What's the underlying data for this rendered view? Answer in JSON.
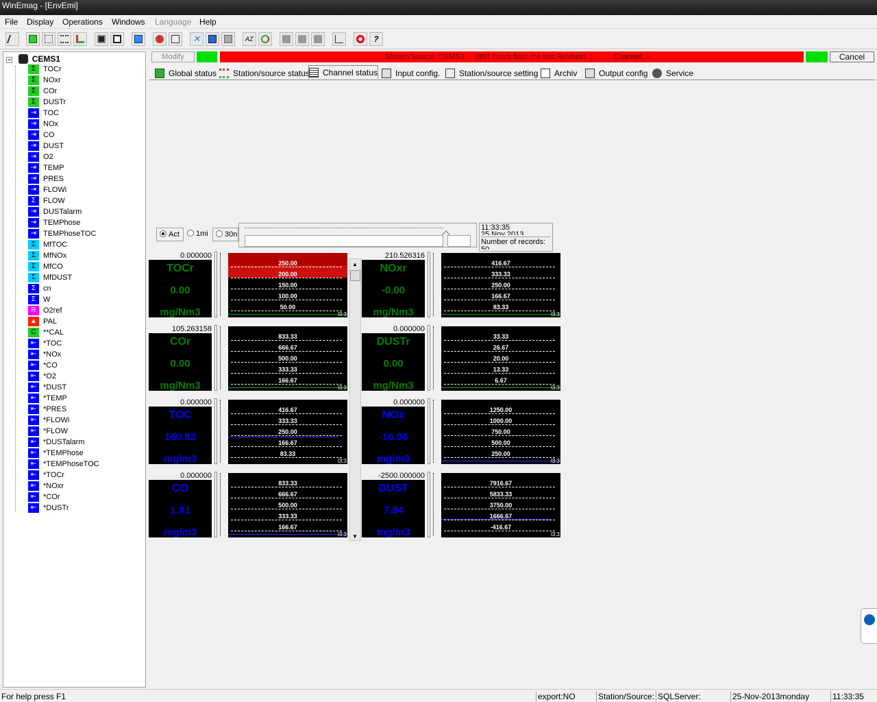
{
  "window": {
    "title": "WinEmag - [EnvEmi]"
  },
  "menu": {
    "file": "File",
    "display": "Display",
    "operations": "Operations",
    "windows": "Windows",
    "language": "Language",
    "help": "Help"
  },
  "tree": {
    "root": "CEMS1",
    "items": [
      {
        "label": "TOCr",
        "icon": "sum-icon",
        "color": "#22cc22"
      },
      {
        "label": "NOxr",
        "icon": "sum-icon",
        "color": "#22cc22"
      },
      {
        "label": "COr",
        "icon": "sum-icon",
        "color": "#22cc22"
      },
      {
        "label": "DUSTr",
        "icon": "sum-icon",
        "color": "#22cc22"
      },
      {
        "label": "TOC",
        "icon": "input-arrow-icon",
        "color": "#0000ff"
      },
      {
        "label": "NOx",
        "icon": "input-arrow-icon",
        "color": "#0000ff"
      },
      {
        "label": "CO",
        "icon": "input-arrow-icon",
        "color": "#0000ff"
      },
      {
        "label": "DUST",
        "icon": "input-arrow-icon",
        "color": "#0000ff"
      },
      {
        "label": "O2",
        "icon": "input-arrow-icon",
        "color": "#0000ff"
      },
      {
        "label": "TEMP",
        "icon": "input-arrow-icon",
        "color": "#0000ff"
      },
      {
        "label": "PRES",
        "icon": "input-arrow-icon",
        "color": "#0000ff"
      },
      {
        "label": "FLOWi",
        "icon": "input-arrow-icon",
        "color": "#0000ff"
      },
      {
        "label": "FLOW",
        "icon": "sum-icon",
        "color": "#0000ff"
      },
      {
        "label": "DUSTalarm",
        "icon": "input-arrow-icon",
        "color": "#0000ff"
      },
      {
        "label": "TEMPhose",
        "icon": "input-arrow-icon",
        "color": "#0000ff"
      },
      {
        "label": "TEMPhoseTOC",
        "icon": "input-arrow-icon",
        "color": "#0000ff"
      },
      {
        "label": "MfTOC",
        "icon": "sum-icon",
        "color": "#00ccff"
      },
      {
        "label": "MfNOx",
        "icon": "sum-icon",
        "color": "#00ccff"
      },
      {
        "label": "MfCO",
        "icon": "sum-icon",
        "color": "#00ccff"
      },
      {
        "label": "MfDUST",
        "icon": "sum-icon",
        "color": "#00ccff"
      },
      {
        "label": "cn",
        "icon": "sum-icon",
        "color": "#0000ff"
      },
      {
        "label": "W",
        "icon": "sum-icon",
        "color": "#0000ff"
      },
      {
        "label": "O2ref",
        "icon": "r-icon",
        "color": "#ff00ff"
      },
      {
        "label": "PAL",
        "icon": "alarm-icon",
        "color": "#ff2200"
      },
      {
        "label": "**CAL",
        "icon": "c-icon",
        "color": "#22cc22"
      },
      {
        "label": "*TOC",
        "icon": "output-arrow-icon",
        "color": "#0000ff"
      },
      {
        "label": "*NOx",
        "icon": "output-arrow-icon",
        "color": "#0000ff"
      },
      {
        "label": "*CO",
        "icon": "output-arrow-icon",
        "color": "#0000ff"
      },
      {
        "label": "*O2",
        "icon": "output-arrow-icon",
        "color": "#0000ff"
      },
      {
        "label": "*DUST",
        "icon": "output-arrow-icon",
        "color": "#0000ff"
      },
      {
        "label": "*TEMP",
        "icon": "output-arrow-icon",
        "color": "#0000ff"
      },
      {
        "label": "*PRES",
        "icon": "output-arrow-icon",
        "color": "#0000ff"
      },
      {
        "label": "*FLOWi",
        "icon": "output-arrow-icon",
        "color": "#0000ff"
      },
      {
        "label": "*FLOW",
        "icon": "output-arrow-icon",
        "color": "#0000ff"
      },
      {
        "label": "*DUSTalarm",
        "icon": "output-arrow-icon",
        "color": "#0000ff"
      },
      {
        "label": "*TEMPhose",
        "icon": "output-arrow-icon",
        "color": "#0000ff"
      },
      {
        "label": "*TEMPhoseTOC",
        "icon": "output-arrow-icon",
        "color": "#0000ff"
      },
      {
        "label": "*TOCr",
        "icon": "output-arrow-icon",
        "color": "#0000ff"
      },
      {
        "label": "*NOxr",
        "icon": "output-arrow-icon",
        "color": "#0000ff"
      },
      {
        "label": "*COr",
        "icon": "output-arrow-icon",
        "color": "#0000ff"
      },
      {
        "label": "*DUSTr",
        "icon": "output-arrow-icon",
        "color": "#0000ff"
      }
    ]
  },
  "infobar": {
    "modify": "Modify",
    "station_text": "Station/Source: CEMS1     (993 hours from the last Revision  )          Channel: --",
    "cancel": "Cancel"
  },
  "tabs": [
    {
      "label": "Global status",
      "icon": "global-status-icon"
    },
    {
      "label": "Station/source status",
      "icon": "station-status-icon"
    },
    {
      "label": "Channel status",
      "icon": "channel-status-icon",
      "active": true
    },
    {
      "label": "Input config.",
      "icon": "input-config-icon"
    },
    {
      "label": "Station/source setting",
      "icon": "station-setting-icon"
    },
    {
      "label": "Archiv",
      "icon": "archiv-icon"
    },
    {
      "label": "Output config",
      "icon": "output-config-icon"
    },
    {
      "label": "Service",
      "icon": "service-icon"
    }
  ],
  "time_controls": {
    "act": "Act",
    "one_min": "1mi",
    "thirty_min": "30n"
  },
  "time_info": {
    "time": "11:33:35",
    "date_partial": "25 Nov 2013",
    "records_label": "Number of records:",
    "records_partial": "50"
  },
  "channels": [
    {
      "name": "TOCr",
      "value": "0.00",
      "unit": "mg/Nm3",
      "top": "0.000000",
      "color": "#008000",
      "scale": [
        "250.00",
        "200.00",
        "150.00",
        "100.00",
        "50.00"
      ],
      "alarm_bands": 2,
      "trace_color": "#00aa00",
      "trace_level": 0.01,
      "time": "l3:3"
    },
    {
      "name": "NOxr",
      "value": "-0.00",
      "unit": "mg/Nm3",
      "top": "210.526316",
      "color": "#008000",
      "scale": [
        "416.67",
        "333.33",
        "250.00",
        "166.67",
        "83.33"
      ],
      "alarm_bands": 0,
      "trace_color": "#00aa00",
      "trace_level": 0.01,
      "time": "l3:3"
    },
    {
      "name": "COr",
      "value": "0.00",
      "unit": "mg/Nm3",
      "top": "105.263158",
      "color": "#008000",
      "scale": [
        "833.33",
        "666.67",
        "500.00",
        "333.33",
        "166.67"
      ],
      "alarm_bands": 0,
      "trace_color": "#00aa00",
      "trace_level": 0.01,
      "time": "l3:3"
    },
    {
      "name": "DUSTr",
      "value": "0.00",
      "unit": "mg/Nm3",
      "top": "0.000000",
      "color": "#008000",
      "scale": [
        "33.33",
        "26.67",
        "20.00",
        "13.33",
        "6.67"
      ],
      "alarm_bands": 0,
      "trace_color": "#00aa00",
      "trace_level": 0.01,
      "time": "l3:3"
    },
    {
      "name": "TOC",
      "value": "160.92",
      "unit": "mg/m3",
      "top": "0.000000",
      "color": "#0000ff",
      "scale": [
        "416.67",
        "333.33",
        "250.00",
        "166.67",
        "83.33"
      ],
      "alarm_bands": 0,
      "trace_color": "#3333ff",
      "trace_level": 0.386,
      "time": "l3:3"
    },
    {
      "name": "NOx",
      "value": "-16.06",
      "unit": "mg/m3",
      "top": "0.000000",
      "color": "#0000ff",
      "scale": [
        "1250.00",
        "1000.00",
        "750.00",
        "500.00",
        "250.00"
      ],
      "alarm_bands": 0,
      "trace_color": "#3333ff",
      "trace_level": 0.01,
      "time": "l3:3"
    },
    {
      "name": "CO",
      "value": "1.81",
      "unit": "mg/m3",
      "top": "0.000000",
      "color": "#0000ff",
      "scale": [
        "833.33",
        "666.67",
        "500.00",
        "333.33",
        "166.67"
      ],
      "alarm_bands": 0,
      "trace_color": "#3333ff",
      "trace_level": 0.01,
      "time": "l3:3"
    },
    {
      "name": "DUST",
      "value": "7.84",
      "unit": "mg/m3",
      "top": "-2500.000000",
      "color": "#0000ff",
      "scale": [
        "7916.67",
        "5833.33",
        "3750.00",
        "1666.67",
        "-416.67"
      ],
      "alarm_bands": 0,
      "trace_color": "#3333ff",
      "trace_level": 0.24,
      "time": "l3:3"
    }
  ],
  "statusbar": {
    "help": "For help press F1",
    "export": "export:NO",
    "station": "Station/Source:",
    "sql": "SQLServer:",
    "date": "25-Nov-2013monday",
    "time": "11:33:35"
  }
}
